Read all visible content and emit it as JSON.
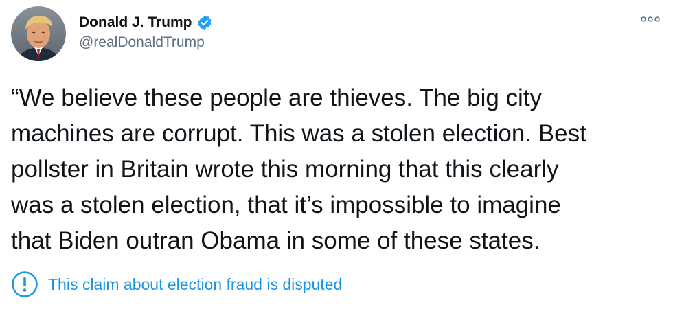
{
  "author": {
    "display_name": "Donald J. Trump",
    "handle": "@realDonaldTrump",
    "verified": true,
    "verified_icon": "verified-badge-icon",
    "avatar_icon": "profile-photo"
  },
  "menu": {
    "icon": "more-options-icon"
  },
  "tweet": {
    "text": "“We believe these people are thieves. The big city\nmachines are corrupt. This was a stolen election. Best\npollster in Britain wrote this morning that this clearly\nwas a stolen election, that it’s impossible to imagine\nthat Biden outran Obama in some of these states."
  },
  "notice": {
    "icon": "exclamation-circle-icon",
    "text": "This claim about election fraud is disputed"
  },
  "colors": {
    "text": "#0f1419",
    "secondary": "#5b7083",
    "accent": "#1b95e0",
    "verified": "#1da1f2"
  }
}
